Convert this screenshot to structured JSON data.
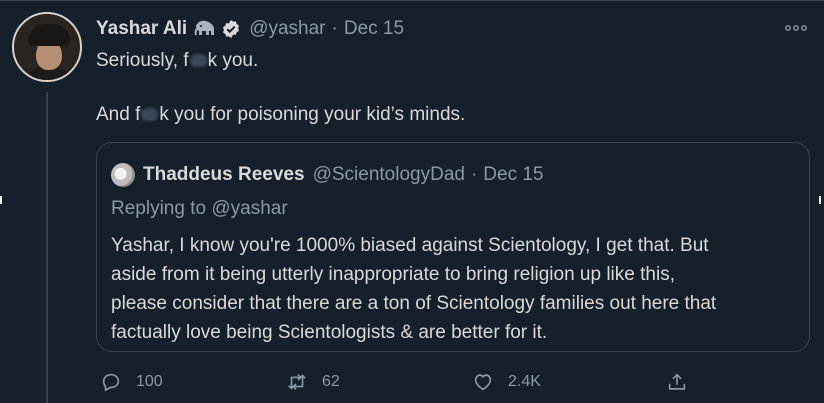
{
  "author": {
    "name": "Yashar Ali",
    "handle": "@yashar",
    "separator": "·",
    "date": "Dec 15",
    "badges": [
      "elephant-icon",
      "verified-icon"
    ]
  },
  "tweet": {
    "line1_before": "Seriously, f",
    "line1_after": "k you.",
    "line2_before": "And f",
    "line2_after": "k you for poisoning your kid’s minds."
  },
  "quoted": {
    "name": "Thaddeus Reeves",
    "handle": "@ScientologyDad",
    "separator": "·",
    "date": "Dec 15",
    "replying_to": "Replying to @yashar",
    "text_lines": [
      "Yashar, I know you're 1000% biased against Scientology, I get that. But",
      "aside from it being utterly inappropriate to bring religion up like this,",
      "please consider that there are a ton of Scientology families out here that",
      "factually love being Scientologists & are better for it."
    ]
  },
  "actions": {
    "reply_count": "100",
    "retweet_count": "62",
    "like_count": "2.4K"
  },
  "colors": {
    "background": "#15202b",
    "text": "#d9d9d9",
    "muted": "#8b98a5",
    "border": "#38444d"
  }
}
